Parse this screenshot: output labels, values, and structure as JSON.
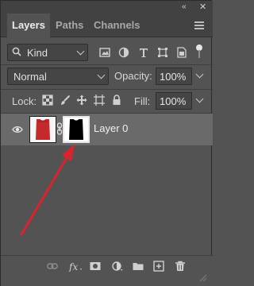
{
  "window": {
    "collapse_glyph": "‹‹",
    "close_glyph": "✕"
  },
  "tabs": [
    {
      "label": "Layers",
      "active": true
    },
    {
      "label": "Paths",
      "active": false
    },
    {
      "label": "Channels",
      "active": false
    }
  ],
  "filter": {
    "kind_label": "Kind",
    "icons": [
      "pixel-layer-filter-icon",
      "adjustment-layer-filter-icon",
      "type-layer-filter-icon",
      "shape-layer-filter-icon",
      "smart-object-filter-icon",
      "filter-toggle-icon"
    ]
  },
  "blend": {
    "mode": "Normal",
    "opacity_label": "Opacity:",
    "opacity_value": "100%"
  },
  "lock": {
    "label": "Lock:",
    "icons": [
      "lock-transparent-pixels-icon",
      "lock-image-pixels-icon",
      "lock-position-icon",
      "lock-artboard-icon",
      "lock-all-icon"
    ],
    "fill_label": "Fill:",
    "fill_value": "100%"
  },
  "layers": [
    {
      "name": "Layer 0",
      "visible": true,
      "has_mask": true,
      "selected": true
    }
  ],
  "bottom_icons": [
    "link-layers-icon",
    "fx-icon",
    "add-mask-icon",
    "adjustment-layer-icon",
    "new-group-icon",
    "new-layer-icon",
    "delete-icon"
  ],
  "colors": {
    "panel_bg": "#535353",
    "tab_bar_bg": "#424242",
    "selected_row": "#6a6a6a",
    "annotation_arrow": "#d9232e",
    "thumbnail_red": "#c42a2a"
  }
}
